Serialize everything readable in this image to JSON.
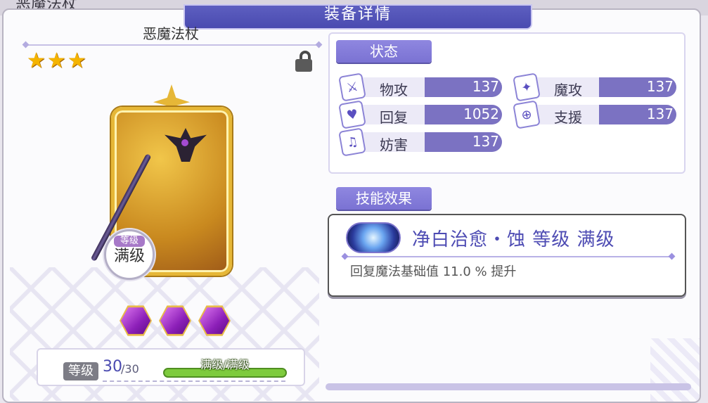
{
  "background": {
    "title": "恶魔法杖"
  },
  "header": {
    "title": "装备详情"
  },
  "item": {
    "name": "恶魔法杖",
    "stars": [
      "★",
      "★",
      "★"
    ],
    "level_badge_label": "等级",
    "level_badge_value": "满级",
    "gem_count": 3
  },
  "level_bar": {
    "label": "等级",
    "current": "30",
    "max": "/30",
    "exp_text": "满级/满级",
    "exp_fill_fraction": 1.0
  },
  "status": {
    "tag": "状态",
    "stats": [
      {
        "name": "物攻",
        "value": "137",
        "icon": "sword-icon",
        "glyph": "⚔"
      },
      {
        "name": "魔攻",
        "value": "137",
        "icon": "wand-icon",
        "glyph": "✦"
      },
      {
        "name": "回复",
        "value": "1052",
        "icon": "heal-icon",
        "glyph": "♥"
      },
      {
        "name": "支援",
        "value": "137",
        "icon": "support-icon",
        "glyph": "⊕"
      },
      {
        "name": "妨害",
        "value": "137",
        "icon": "debuff-icon",
        "glyph": "♫"
      }
    ]
  },
  "skill": {
    "tag": "技能效果",
    "title": "净白治愈・蚀  等级 满级",
    "description": "回复魔法基础值 11.0 % 提升"
  },
  "colors": {
    "accent": "#7a72d3",
    "header": "#4a4ab0",
    "gold": "#e6b737",
    "gem": "#8c1fb8",
    "exp": "#7ecb3d"
  }
}
